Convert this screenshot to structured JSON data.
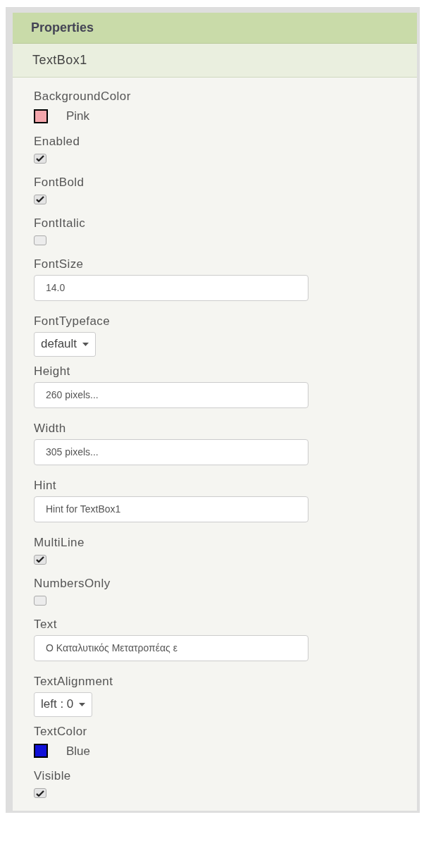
{
  "panel": {
    "title": "Properties",
    "component": "TextBox1"
  },
  "properties": [
    {
      "kind": "color",
      "label": "BackgroundColor",
      "value": "Pink",
      "color": "#f4a6ac"
    },
    {
      "kind": "checkbox",
      "label": "Enabled",
      "checked": true
    },
    {
      "kind": "checkbox",
      "label": "FontBold",
      "checked": true
    },
    {
      "kind": "checkbox",
      "label": "FontItalic",
      "checked": false
    },
    {
      "kind": "text",
      "label": "FontSize",
      "value": "14.0"
    },
    {
      "kind": "dropdown",
      "label": "FontTypeface",
      "value": "default"
    },
    {
      "kind": "text",
      "label": "Height",
      "value": "260 pixels..."
    },
    {
      "kind": "text",
      "label": "Width",
      "value": "305 pixels..."
    },
    {
      "kind": "text",
      "label": "Hint",
      "value": "Hint for TextBox1"
    },
    {
      "kind": "checkbox",
      "label": "MultiLine",
      "checked": true
    },
    {
      "kind": "checkbox",
      "label": "NumbersOnly",
      "checked": false
    },
    {
      "kind": "text",
      "label": "Text",
      "value": "Ο Καταλυτικός Μετατροπέας ε"
    },
    {
      "kind": "dropdown",
      "label": "TextAlignment",
      "value": "left : 0"
    },
    {
      "kind": "color",
      "label": "TextColor",
      "value": "Blue",
      "color": "#1010d8"
    },
    {
      "kind": "checkbox",
      "label": "Visible",
      "checked": true
    }
  ]
}
